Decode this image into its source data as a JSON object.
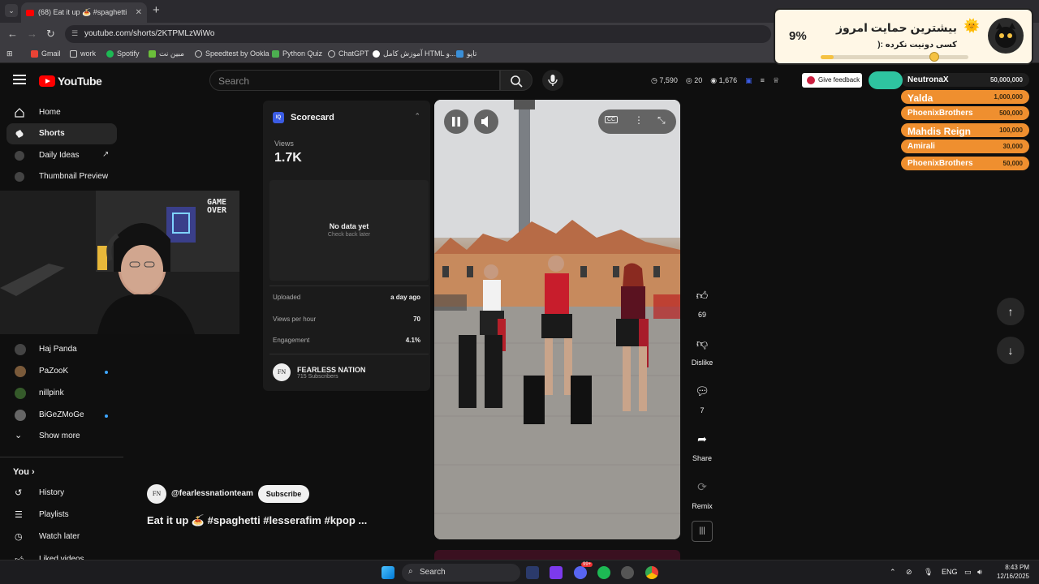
{
  "browser": {
    "tab_title": "(68) Eat it up 🍝 #spaghetti",
    "url": "youtube.com/shorts/2KTPMLzWiWo",
    "bookmarks": [
      "Gmail",
      "work",
      "Spotify",
      "مبین نت",
      "Speedtest by Ookla",
      "Python Quiz",
      "ChatGPT",
      "آموزش کامل HTML و...",
      "تاپو"
    ]
  },
  "youtube": {
    "logo": "YouTube",
    "search_placeholder": "Search",
    "stats": [
      "7,590",
      "20",
      "1,676"
    ],
    "feedback_label": "Give feedback"
  },
  "sidebar": {
    "items": [
      {
        "label": "Home",
        "icon": "home-icon"
      },
      {
        "label": "Shorts",
        "icon": "shorts-icon"
      },
      {
        "label": "Daily Ideas",
        "icon": "ideas-icon"
      },
      {
        "label": "Thumbnail Preview",
        "icon": "thumbnail-icon"
      }
    ],
    "subscriptions": [
      {
        "label": "Haj Panda"
      },
      {
        "label": "PaZooK"
      },
      {
        "label": "nillpink"
      },
      {
        "label": "BiGeZMoGe"
      }
    ],
    "show_more": "Show more",
    "you_label": "You",
    "you_items": [
      "History",
      "Playlists",
      "Watch later",
      "Liked videos"
    ]
  },
  "scorecard": {
    "title": "Scorecard",
    "views_label": "Views",
    "views": "1.7K",
    "no_data": "No data yet",
    "check_back": "Check back later",
    "rows": [
      {
        "label": "Uploaded",
        "value": "a day ago"
      },
      {
        "label": "Views per hour",
        "value": "70"
      },
      {
        "label": "Engagement",
        "value": "4.1%"
      }
    ],
    "channel_name": "FEARLESS NATION",
    "channel_subs": "715 Subscribers",
    "channel_initials": "FN"
  },
  "short": {
    "channel_handle": "@fearlessnationteam",
    "subscribe_label": "Subscribe",
    "title": "Eat it up 🍝 #spaghetti #lesserafim #kpop ...",
    "likes": "69",
    "dislike_label": "Dislike",
    "comments": "7",
    "share_label": "Share",
    "remix_label": "Remix"
  },
  "donation": {
    "percent": "9%",
    "percent_value": 0.09,
    "title": "بیشترین حمایت امروز",
    "subtitle": "کسی دونیت نکرده :(",
    "leaderboard": [
      {
        "name": "NeutronaX",
        "amount": "50,000,000"
      },
      {
        "name": "Yalda",
        "amount": "1,000,000"
      },
      {
        "name": "PhoenixBrothers",
        "amount": "500,000"
      },
      {
        "name": "Mahdis Reign",
        "amount": "100,000"
      },
      {
        "name": "Amirali",
        "amount": "30,000"
      },
      {
        "name": "PhoenixBrothers",
        "amount": "50,000"
      }
    ]
  },
  "taskbar": {
    "search_label": "Search",
    "lang": "ENG",
    "time": "8:43 PM",
    "date": "12/16/2025",
    "badge": "99+"
  },
  "webcam_overlay_text": "GAME OVER"
}
